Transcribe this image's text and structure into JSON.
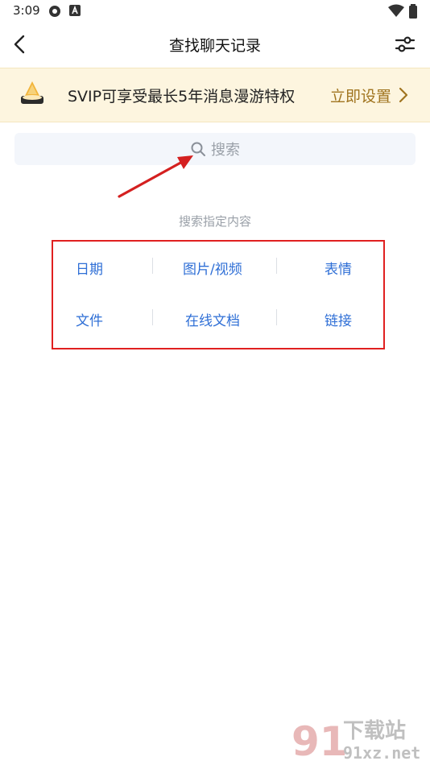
{
  "status_bar": {
    "time": "3:09",
    "icons": [
      "sync-icon",
      "a-badge-icon",
      "wifi-icon",
      "battery-icon"
    ]
  },
  "nav": {
    "title": "查找聊天记录",
    "back_icon": "chevron-left-icon",
    "filter_icon": "sliders-icon"
  },
  "banner": {
    "text": "SVIP可享受最长5年消息漫游特权",
    "action": "立即设置",
    "icon": "vip-crown-icon",
    "accent": "#a0741f",
    "background": "#fdf5df"
  },
  "search": {
    "placeholder": "搜索",
    "icon": "search-icon"
  },
  "categories": {
    "label": "搜索指定内容",
    "items": [
      "日期",
      "图片/视频",
      "表情",
      "文件",
      "在线文档",
      "链接"
    ],
    "color": "#2f6fd6"
  },
  "watermark": {
    "logo": "91",
    "title": "下载站",
    "url": "91xz.net"
  }
}
